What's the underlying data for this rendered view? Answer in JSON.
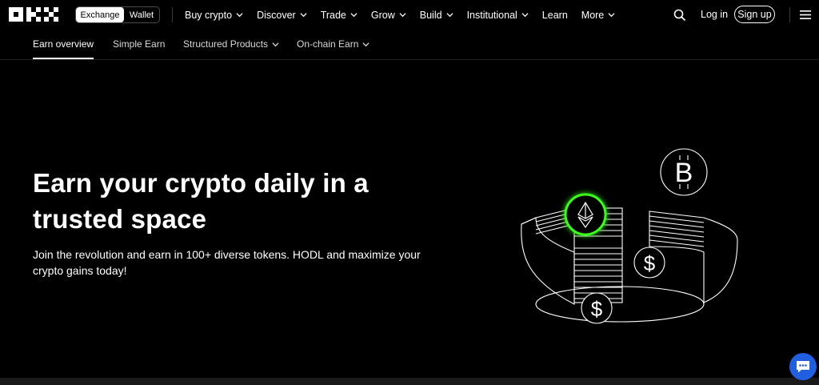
{
  "header": {
    "logo": "OKX",
    "toggle": {
      "exchange": "Exchange",
      "wallet": "Wallet"
    },
    "nav": [
      {
        "label": "Buy crypto",
        "chevron": true
      },
      {
        "label": "Discover",
        "chevron": true
      },
      {
        "label": "Trade",
        "chevron": true
      },
      {
        "label": "Grow",
        "chevron": true
      },
      {
        "label": "Build",
        "chevron": true
      },
      {
        "label": "Institutional",
        "chevron": true
      },
      {
        "label": "Learn",
        "chevron": false
      },
      {
        "label": "More",
        "chevron": true
      }
    ],
    "login": "Log in",
    "signup": "Sign up"
  },
  "subnav": {
    "items": [
      {
        "label": "Earn overview",
        "active": true
      },
      {
        "label": "Simple Earn"
      },
      {
        "label": "Structured Products",
        "chevron": true
      },
      {
        "label": "On-chain Earn",
        "chevron": true
      }
    ]
  },
  "hero": {
    "title_line1": "Earn your crypto daily in a",
    "title_line2": "trusted space",
    "subtitle_line1": "Join the revolution and earn in 100+ diverse tokens. HODL and maximize your",
    "subtitle_line2": "crypto gains today!"
  },
  "colors": {
    "background": "#000000",
    "accent_green": "#39ff14",
    "chat_blue": "#1f5fe0"
  },
  "icons": {
    "search": "search-icon",
    "menu": "hamburger-menu-icon",
    "chat": "chat-icon",
    "bitcoin": "bitcoin-icon",
    "ethereum": "ethereum-icon",
    "dollar": "dollar-coin-icon"
  }
}
